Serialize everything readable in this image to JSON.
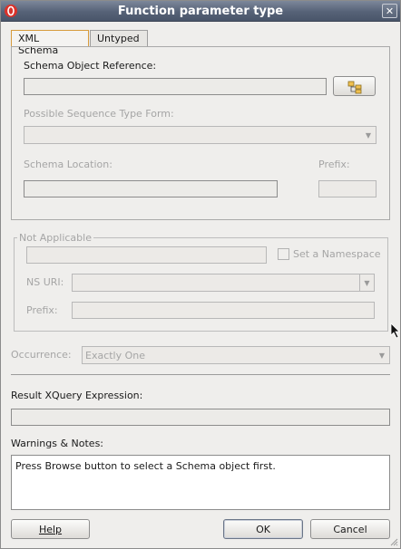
{
  "window": {
    "title": "Function parameter type"
  },
  "tabs": [
    {
      "label": "XML Schema",
      "active": true
    },
    {
      "label": "Untyped",
      "active": false
    }
  ],
  "schema": {
    "object_reference_label": "Schema Object Reference:",
    "object_reference_value": "",
    "sequence_type_label": "Possible Sequence Type Form:",
    "sequence_type_value": "",
    "location_label": "Schema Location:",
    "location_value": "",
    "prefix_label": "Prefix:",
    "prefix_value": ""
  },
  "namespace": {
    "group_label": "Not Applicable",
    "value": "",
    "set_namespace_label": "Set a Namespace",
    "set_namespace_checked": false,
    "ns_uri_label": "NS URI:",
    "ns_uri_value": "",
    "prefix_label": "Prefix:",
    "prefix_value": ""
  },
  "occurrence": {
    "label": "Occurrence:",
    "value": "Exactly One"
  },
  "result": {
    "label": "Result XQuery Expression:",
    "value": ""
  },
  "warnings": {
    "label": "Warnings & Notes:",
    "text": "Press Browse button to select a Schema object first."
  },
  "buttons": {
    "help": "Help",
    "ok": "OK",
    "cancel": "Cancel"
  },
  "icons": {
    "app": "oracle-logo-icon",
    "close": "close-icon",
    "browse": "hierarchy-tree-icon",
    "dropdown": "chevron-down-icon",
    "cursor": "mouse-pointer-icon"
  },
  "colors": {
    "titlebar": "#566277",
    "tab_highlight": "#d79b3c",
    "disabled_text": "#a5a5a5"
  }
}
